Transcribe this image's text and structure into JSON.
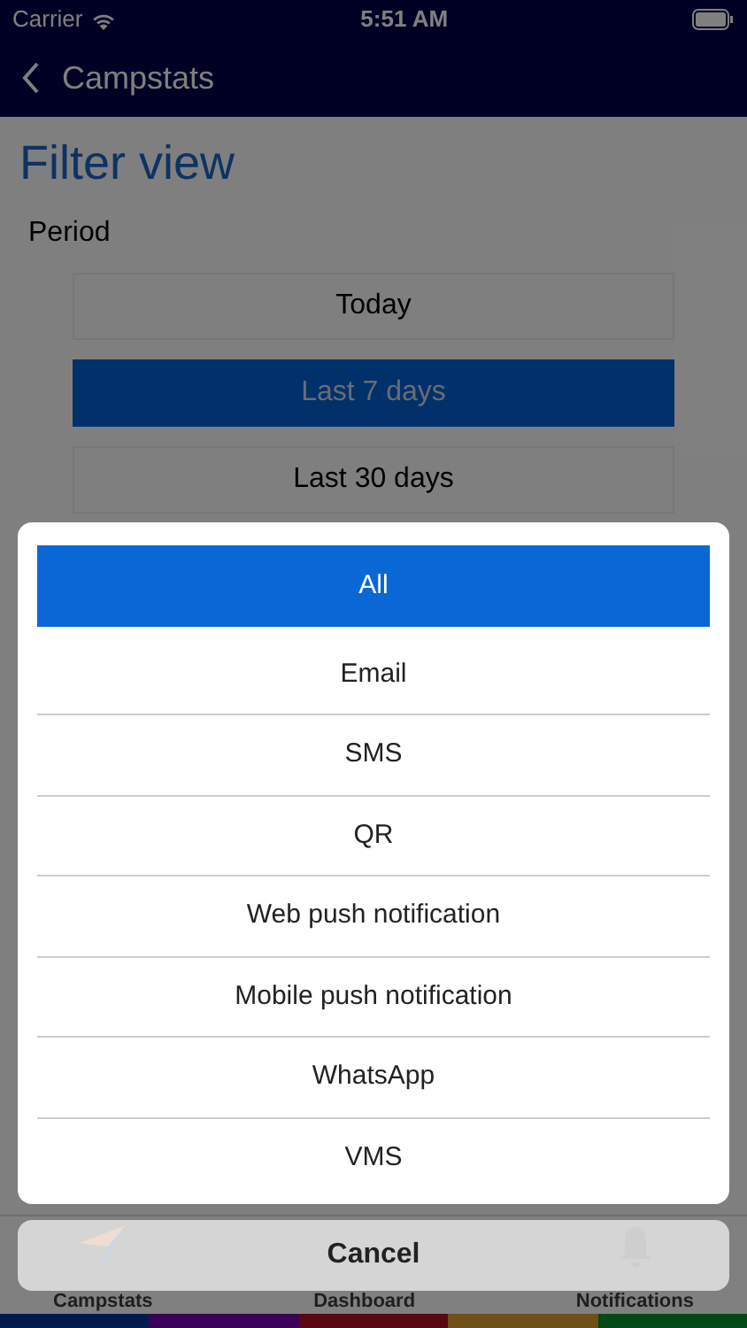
{
  "status_bar": {
    "carrier": "Carrier",
    "time": "5:51 AM"
  },
  "nav_bar": {
    "back_label": "Campstats"
  },
  "title": "Filter view",
  "period": {
    "label": "Period",
    "options": [
      {
        "label": "Today",
        "selected": false
      },
      {
        "label": "Last 7 days",
        "selected": true
      },
      {
        "label": "Last 30 days",
        "selected": false
      }
    ]
  },
  "action_sheet": {
    "options": [
      {
        "label": "All",
        "selected": true
      },
      {
        "label": "Email",
        "selected": false
      },
      {
        "label": "SMS",
        "selected": false
      },
      {
        "label": "QR",
        "selected": false
      },
      {
        "label": "Web push notification",
        "selected": false
      },
      {
        "label": "Mobile push notification",
        "selected": false
      },
      {
        "label": "WhatsApp",
        "selected": false
      },
      {
        "label": "VMS",
        "selected": false
      }
    ],
    "cancel": "Cancel"
  },
  "tab_bar": {
    "tabs": [
      {
        "label": "Campstats",
        "kind": "plane"
      },
      {
        "label": "Dashboard",
        "kind": "none"
      },
      {
        "label": "Notifications",
        "kind": "bell"
      }
    ]
  }
}
